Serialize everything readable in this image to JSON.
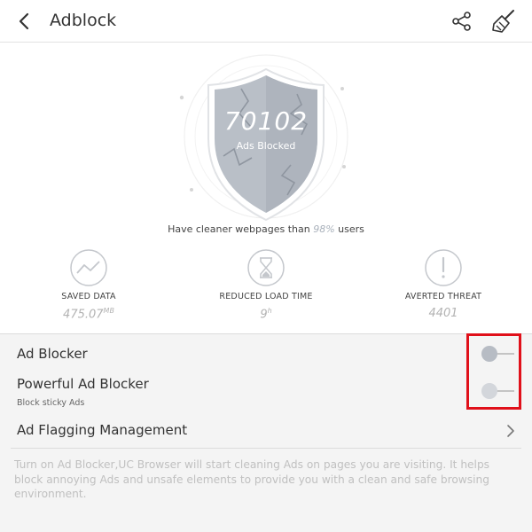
{
  "header": {
    "title": "Adblock",
    "back_icon": "back-arrow-icon",
    "share_icon": "share-icon",
    "clean_icon": "broom-icon"
  },
  "shield": {
    "count": "70102",
    "label": "Ads Blocked"
  },
  "comparison": {
    "prefix": "Have cleaner webpages than ",
    "percent": "98%",
    "suffix": " users"
  },
  "stats": {
    "saved_data": {
      "label": "SAVED DATA",
      "value": "475.07",
      "unit": "MB",
      "icon": "chart-line-icon"
    },
    "reduced_load_time": {
      "label": "REDUCED LOAD TIME",
      "value": "9",
      "unit": "h",
      "icon": "hourglass-icon"
    },
    "averted_threat": {
      "label": "AVERTED THREAT",
      "value": "4401",
      "icon": "exclamation-icon"
    }
  },
  "settings": {
    "ad_blocker": {
      "label": "Ad Blocker",
      "enabled": false
    },
    "powerful_ad_blocker": {
      "label": "Powerful Ad Blocker",
      "sublabel": "Block sticky Ads",
      "enabled": false
    },
    "ad_flagging": {
      "label": "Ad Flagging Management",
      "icon": "chevron-right-icon"
    }
  },
  "description": "Turn on Ad Blocker,UC Browser will start cleaning Ads on pages you are visiting. It helps block annoying Ads and unsafe elements to provide you with a clean and safe browsing environment.",
  "colors": {
    "shield": "#b9bfc7",
    "toggle_off_knob": "#b7bcc4",
    "highlight": "#e0101a",
    "muted_text": "#c0c0c0"
  }
}
